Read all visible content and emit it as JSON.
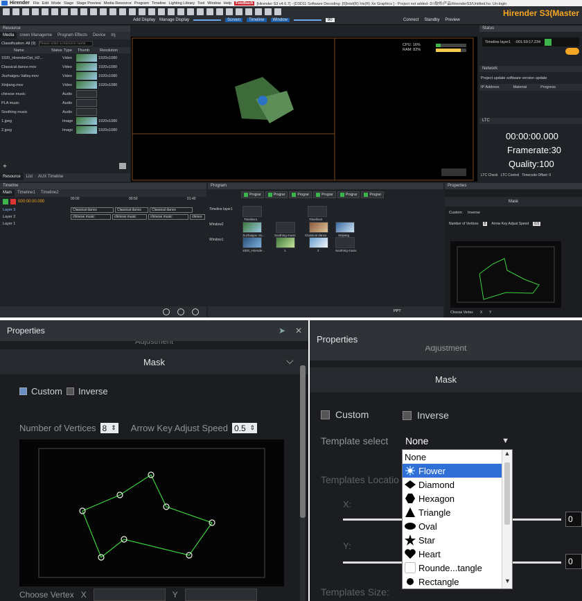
{
  "app": {
    "title_bar": {
      "app_name": "Hirender",
      "menus": [
        "File",
        "Edit",
        "Mode",
        "Stage",
        "Stage Preview",
        "Media Resource",
        "Program",
        "Timeline",
        "Lighting Library",
        "Tool",
        "Window",
        "Help"
      ],
      "feedback": "Feedback",
      "path_text": "[Hirender S3 v4.6.7] - [D3D11 Software Decoding: [0]Intel(R) Iris(R) Xe Graphics ] - Project not added- D:/软件/产品/HirenderS3/Untitled.hs: Un-login"
    },
    "brand": "Hirender S3(Master",
    "toolbar": {
      "add_display": "Add Display",
      "manage_display": "Manage Display",
      "screen": "Screen",
      "timeline": "Timeline",
      "window": "Window",
      "value_80": "80",
      "connect": "Connect",
      "standby": "Standby",
      "preview": "Preview"
    },
    "resource": {
      "header": "Resource",
      "tabs": [
        "Media",
        "creen Manageme",
        "Program Effects",
        "Device",
        "Inj"
      ],
      "classification": "Classification: All (9)",
      "search_placeholder": "Please enter a resource name",
      "columns": [
        "Name",
        "Status",
        "Type",
        "Thumb",
        "Resolution"
      ],
      "rows": [
        {
          "name": "1920_HirenderOpt_H2...",
          "type": "Video",
          "res": "1920x1080"
        },
        {
          "name": "Classical dance.mov",
          "type": "Video",
          "res": "1920x1080"
        },
        {
          "name": "Jiuzhaigou Valley.mov",
          "type": "Video",
          "res": "1920x1080"
        },
        {
          "name": "Xinjiang.mov",
          "type": "Video",
          "res": "1920x1080"
        },
        {
          "name": "chinese music",
          "type": "Audio",
          "res": ""
        },
        {
          "name": "PLA music",
          "type": "Audio",
          "res": ""
        },
        {
          "name": "Soothing music",
          "type": "Audio",
          "res": ""
        },
        {
          "name": "1.jpeg",
          "type": "Image",
          "res": "1920x1080"
        },
        {
          "name": "2.jpeg",
          "type": "Image",
          "res": "1920x1080"
        }
      ],
      "bottom_tabs": [
        "Resource",
        "List",
        "AUX Timeline"
      ]
    },
    "preview": {
      "cpu": "CPU:  16%",
      "ram": "RAM:  82%"
    },
    "status": {
      "header": "Status",
      "timeline_layer": "Timeline layer1",
      "time": "-001:59:17.234",
      "network": "Network",
      "project_update": "Project update",
      "software_update": "software version update",
      "columns": [
        "IP Address",
        "Material",
        "Progress"
      ],
      "ltc": "LTC",
      "ltc_time": "00:00:00.000",
      "framerate": "Framerate:30",
      "quality": "Quality:100",
      "ltc_check": "LTC Check",
      "ltc_control": "LTC Control",
      "timecode_offset": "Timecode Offset: 0"
    },
    "timeline": {
      "header": "Timeline",
      "tabs": [
        "Main",
        "Timeline1",
        "Timeline2"
      ],
      "timecode": "000:00:00.000",
      "ticks": [
        "00:00",
        "00:50",
        "01:40"
      ],
      "layers": [
        "Layer 3",
        "Layer 2",
        "Layer 1"
      ],
      "clips_l3": [
        "Classical dance",
        "Classical dance",
        "Classical dance"
      ],
      "clips_l2": [
        "chinese music",
        "chinese music",
        "chinese music",
        "chines"
      ]
    },
    "program": {
      "header": "Program",
      "buttons": [
        "Prograr",
        "Prograr",
        "Prograr",
        "Prograr",
        "Prograr",
        "Prograr"
      ],
      "rows": [
        "Timeline layer1",
        "Window2",
        "Window1"
      ],
      "labels_row1": [
        "Timeline1",
        "Timeline2"
      ],
      "labels_row2": [
        "Jiuzhaigou Va...",
        "Soothing music",
        "Classical dance",
        "Xinjiang"
      ],
      "labels_row3": [
        "1920_Hirende...",
        "1",
        "2",
        "Soothing music"
      ],
      "ppt": "PPT"
    },
    "properties_small": {
      "header": "Properties",
      "mask": "Mask",
      "custom": "Custom",
      "inverse": "Inverse",
      "nov": "Number of Vertices",
      "nov_val": "8",
      "aka": "Arrow Key Adjust Speed",
      "aka_val": "0.5",
      "choose_vertex": "Choose Vertex",
      "x": "X",
      "y": "Y"
    }
  },
  "panel_left": {
    "header": "Properties",
    "partial": "Adjustment",
    "mask": "Mask",
    "custom": "Custom",
    "inverse": "Inverse",
    "nov": "Number of Vertices",
    "nov_val": "8",
    "aka": "Arrow Key Adjust Speed",
    "aka_val": "0.5",
    "choose_vertex": "Choose Vertex",
    "x": "X",
    "y": "Y",
    "custom_checked": true
  },
  "panel_right": {
    "header": "Properties",
    "partial": "Adjustment",
    "mask": "Mask",
    "custom": "Custom",
    "inverse": "Inverse",
    "template_select": "Template select",
    "selected_value": "None",
    "templates_location": "Templates Locatio",
    "x": "X:",
    "y": "Y:",
    "x_val": "0",
    "y_val": "0",
    "templates_size": "Templates Size:",
    "options": [
      {
        "label": "None",
        "icon": ""
      },
      {
        "label": "Flower",
        "icon": "flower-icon"
      },
      {
        "label": "Diamond",
        "icon": "diamond-icon"
      },
      {
        "label": "Hexagon",
        "icon": "hexagon-icon"
      },
      {
        "label": "Triangle",
        "icon": "triangle-icon"
      },
      {
        "label": "Oval",
        "icon": "oval-icon"
      },
      {
        "label": "Star",
        "icon": "star-icon"
      },
      {
        "label": "Heart",
        "icon": "heart-icon"
      },
      {
        "label": "Rounde...tangle",
        "icon": "rounded-rectangle-icon"
      },
      {
        "label": "Rectangle",
        "icon": "rectangle-icon"
      }
    ],
    "highlighted": "Flower"
  },
  "colors": {
    "accent": "#f5a623",
    "selection": "#2f6fd6",
    "mask_line": "#3dd13d"
  }
}
